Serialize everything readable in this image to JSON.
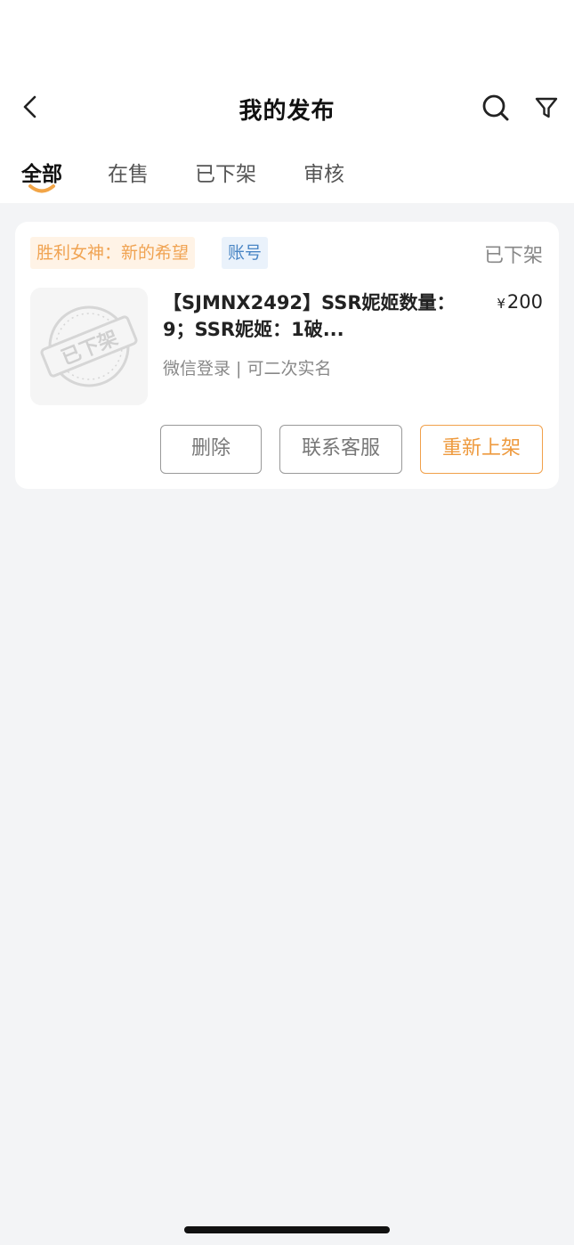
{
  "header": {
    "title": "我的发布"
  },
  "tabs": [
    {
      "label": "全部",
      "active": true
    },
    {
      "label": "在售",
      "active": false
    },
    {
      "label": "已下架",
      "active": false
    },
    {
      "label": "审核",
      "active": false
    }
  ],
  "listing": {
    "game_tag": "胜利女神：新的希望",
    "type_tag": "账号",
    "status": "已下架",
    "title": "【SJMNX2492】SSR妮姬数量：9；SSR妮姬：1破...",
    "price_symbol": "¥",
    "price": "200",
    "login_info": "微信登录 | 可二次实名",
    "stamp_text": "已下架",
    "buttons": {
      "delete": "删除",
      "contact_service": "联系客服",
      "relist": "重新上架"
    }
  },
  "colors": {
    "accent": "#f0a352",
    "type_tag": "#4a86c5",
    "background": "#f3f4f6"
  },
  "icons": [
    "back-arrow-icon",
    "search-icon",
    "filter-icon"
  ]
}
